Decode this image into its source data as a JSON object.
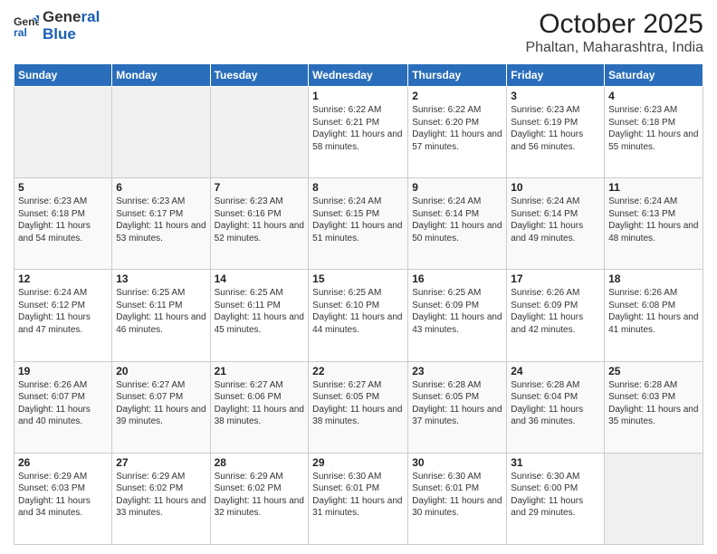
{
  "header": {
    "logo_line1": "General",
    "logo_line2": "Blue",
    "title": "October 2025",
    "subtitle": "Phaltan, Maharashtra, India"
  },
  "days_of_week": [
    "Sunday",
    "Monday",
    "Tuesday",
    "Wednesday",
    "Thursday",
    "Friday",
    "Saturday"
  ],
  "weeks": [
    [
      {
        "day": "",
        "info": ""
      },
      {
        "day": "",
        "info": ""
      },
      {
        "day": "",
        "info": ""
      },
      {
        "day": "1",
        "info": "Sunrise: 6:22 AM\nSunset: 6:21 PM\nDaylight: 11 hours and 58 minutes."
      },
      {
        "day": "2",
        "info": "Sunrise: 6:22 AM\nSunset: 6:20 PM\nDaylight: 11 hours and 57 minutes."
      },
      {
        "day": "3",
        "info": "Sunrise: 6:23 AM\nSunset: 6:19 PM\nDaylight: 11 hours and 56 minutes."
      },
      {
        "day": "4",
        "info": "Sunrise: 6:23 AM\nSunset: 6:18 PM\nDaylight: 11 hours and 55 minutes."
      }
    ],
    [
      {
        "day": "5",
        "info": "Sunrise: 6:23 AM\nSunset: 6:18 PM\nDaylight: 11 hours and 54 minutes."
      },
      {
        "day": "6",
        "info": "Sunrise: 6:23 AM\nSunset: 6:17 PM\nDaylight: 11 hours and 53 minutes."
      },
      {
        "day": "7",
        "info": "Sunrise: 6:23 AM\nSunset: 6:16 PM\nDaylight: 11 hours and 52 minutes."
      },
      {
        "day": "8",
        "info": "Sunrise: 6:24 AM\nSunset: 6:15 PM\nDaylight: 11 hours and 51 minutes."
      },
      {
        "day": "9",
        "info": "Sunrise: 6:24 AM\nSunset: 6:14 PM\nDaylight: 11 hours and 50 minutes."
      },
      {
        "day": "10",
        "info": "Sunrise: 6:24 AM\nSunset: 6:14 PM\nDaylight: 11 hours and 49 minutes."
      },
      {
        "day": "11",
        "info": "Sunrise: 6:24 AM\nSunset: 6:13 PM\nDaylight: 11 hours and 48 minutes."
      }
    ],
    [
      {
        "day": "12",
        "info": "Sunrise: 6:24 AM\nSunset: 6:12 PM\nDaylight: 11 hours and 47 minutes."
      },
      {
        "day": "13",
        "info": "Sunrise: 6:25 AM\nSunset: 6:11 PM\nDaylight: 11 hours and 46 minutes."
      },
      {
        "day": "14",
        "info": "Sunrise: 6:25 AM\nSunset: 6:11 PM\nDaylight: 11 hours and 45 minutes."
      },
      {
        "day": "15",
        "info": "Sunrise: 6:25 AM\nSunset: 6:10 PM\nDaylight: 11 hours and 44 minutes."
      },
      {
        "day": "16",
        "info": "Sunrise: 6:25 AM\nSunset: 6:09 PM\nDaylight: 11 hours and 43 minutes."
      },
      {
        "day": "17",
        "info": "Sunrise: 6:26 AM\nSunset: 6:09 PM\nDaylight: 11 hours and 42 minutes."
      },
      {
        "day": "18",
        "info": "Sunrise: 6:26 AM\nSunset: 6:08 PM\nDaylight: 11 hours and 41 minutes."
      }
    ],
    [
      {
        "day": "19",
        "info": "Sunrise: 6:26 AM\nSunset: 6:07 PM\nDaylight: 11 hours and 40 minutes."
      },
      {
        "day": "20",
        "info": "Sunrise: 6:27 AM\nSunset: 6:07 PM\nDaylight: 11 hours and 39 minutes."
      },
      {
        "day": "21",
        "info": "Sunrise: 6:27 AM\nSunset: 6:06 PM\nDaylight: 11 hours and 38 minutes."
      },
      {
        "day": "22",
        "info": "Sunrise: 6:27 AM\nSunset: 6:05 PM\nDaylight: 11 hours and 38 minutes."
      },
      {
        "day": "23",
        "info": "Sunrise: 6:28 AM\nSunset: 6:05 PM\nDaylight: 11 hours and 37 minutes."
      },
      {
        "day": "24",
        "info": "Sunrise: 6:28 AM\nSunset: 6:04 PM\nDaylight: 11 hours and 36 minutes."
      },
      {
        "day": "25",
        "info": "Sunrise: 6:28 AM\nSunset: 6:03 PM\nDaylight: 11 hours and 35 minutes."
      }
    ],
    [
      {
        "day": "26",
        "info": "Sunrise: 6:29 AM\nSunset: 6:03 PM\nDaylight: 11 hours and 34 minutes."
      },
      {
        "day": "27",
        "info": "Sunrise: 6:29 AM\nSunset: 6:02 PM\nDaylight: 11 hours and 33 minutes."
      },
      {
        "day": "28",
        "info": "Sunrise: 6:29 AM\nSunset: 6:02 PM\nDaylight: 11 hours and 32 minutes."
      },
      {
        "day": "29",
        "info": "Sunrise: 6:30 AM\nSunset: 6:01 PM\nDaylight: 11 hours and 31 minutes."
      },
      {
        "day": "30",
        "info": "Sunrise: 6:30 AM\nSunset: 6:01 PM\nDaylight: 11 hours and 30 minutes."
      },
      {
        "day": "31",
        "info": "Sunrise: 6:30 AM\nSunset: 6:00 PM\nDaylight: 11 hours and 29 minutes."
      },
      {
        "day": "",
        "info": ""
      }
    ]
  ]
}
